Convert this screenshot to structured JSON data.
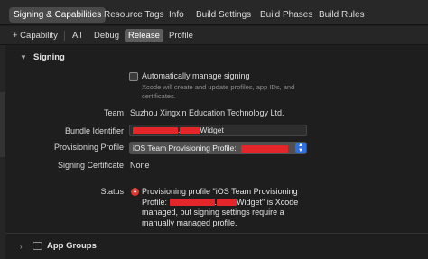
{
  "tabs": [
    {
      "label": "Signing & Capabilities",
      "active": true
    },
    {
      "label": "Resource Tags",
      "active": false
    },
    {
      "label": "Info",
      "active": false
    },
    {
      "label": "Build Settings",
      "active": false
    },
    {
      "label": "Build Phases",
      "active": false
    },
    {
      "label": "Build Rules",
      "active": false
    }
  ],
  "filter": {
    "add_capability": "+ Capability",
    "items": [
      {
        "label": "All",
        "active": false
      },
      {
        "label": "Debug",
        "active": false
      },
      {
        "label": "Release",
        "active": true
      },
      {
        "label": "Profile",
        "active": false
      }
    ]
  },
  "signing": {
    "section_title": "Signing",
    "auto_manage_label": "Automatically manage signing",
    "auto_manage_checked": false,
    "auto_manage_help": "Xcode will create and update profiles, app IDs, and certificates.",
    "team_label": "Team",
    "team_value": "Suzhou Xingxin Education Technology Ltd.",
    "bundle_label": "Bundle Identifier",
    "bundle_suffix": "Widget",
    "profile_label": "Provisioning Profile",
    "profile_value": "iOS Team Provisioning Profile:",
    "certificate_label": "Signing Certificate",
    "certificate_value": "None",
    "status_label": "Status",
    "status_line1": "Provisioning profile \"iOS Team Provisioning",
    "status_line2_pre": "Profile:",
    "status_line2_post": "Widget\" is Xcode",
    "status_line3": "managed, but signing settings require a",
    "status_line4": "manually managed profile."
  },
  "app_groups": {
    "section_title": "App Groups"
  },
  "colors": {
    "accent": "#2f6fe0",
    "error": "#e0382e",
    "redaction": "#e4262a"
  }
}
